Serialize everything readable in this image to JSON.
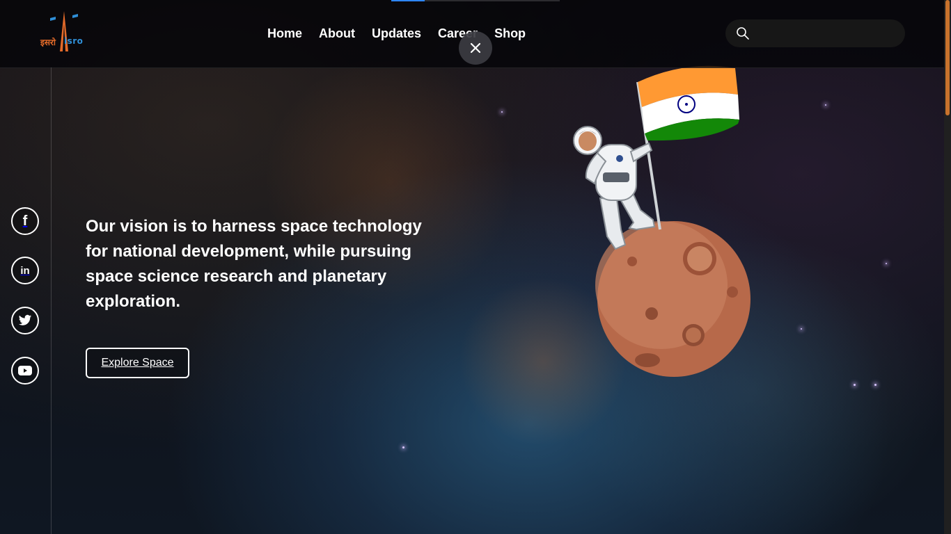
{
  "header": {
    "progress_fraction": 0.2,
    "logo": {
      "hindi_text": "इसरो",
      "english_text": "isro",
      "icon": "isro-rocket-logo-icon"
    },
    "nav": [
      {
        "label": "Home"
      },
      {
        "label": "About"
      },
      {
        "label": "Updates"
      },
      {
        "label": "Career"
      },
      {
        "label": "Shop"
      }
    ],
    "search": {
      "placeholder": "",
      "value": "",
      "icon": "search-icon"
    },
    "close_icon": "close-icon"
  },
  "social": [
    {
      "icon": "facebook-icon",
      "glyph": "f"
    },
    {
      "icon": "linkedin-icon",
      "glyph": "in"
    },
    {
      "icon": "twitter-icon",
      "glyph": ""
    },
    {
      "icon": "youtube-icon",
      "glyph": ""
    }
  ],
  "hero": {
    "text": "Our vision is to harness space technology for national development, while pursuing space science research and planetary exploration.",
    "button_label": "Explore Space"
  },
  "colors": {
    "accent_orange": "#c8722c",
    "progress_blue": "#2e86ff",
    "flag_saffron": "#ff9933",
    "flag_green": "#138808",
    "chakra_navy": "#000080"
  }
}
